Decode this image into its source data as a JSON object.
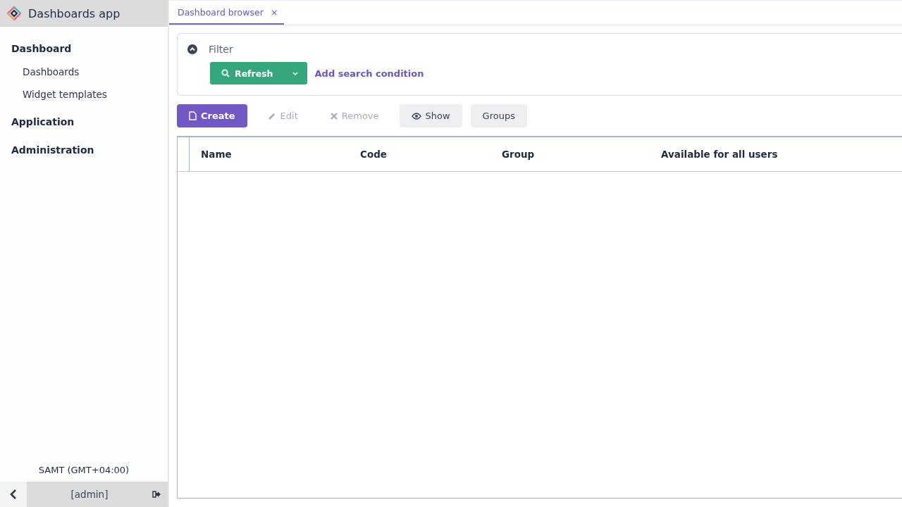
{
  "app": {
    "title": "Dashboards app"
  },
  "sidebar": {
    "sections": [
      {
        "label": "Dashboard",
        "children": [
          {
            "label": "Dashboards"
          },
          {
            "label": "Widget templates"
          }
        ]
      },
      {
        "label": "Application"
      },
      {
        "label": "Administration"
      }
    ],
    "timezone": "SAMT (GMT+04:00)",
    "user": "[admin]"
  },
  "tabs": [
    {
      "label": "Dashboard browser",
      "selected": true,
      "close": "×"
    }
  ],
  "filter": {
    "label": "Filter",
    "expanded": true,
    "refresh": "Refresh",
    "add_condition": "Add search condition"
  },
  "toolbar": [
    {
      "label": "Create",
      "kind": "primary",
      "disabled": false
    },
    {
      "label": "Edit",
      "kind": "plain",
      "disabled": true
    },
    {
      "label": "Remove",
      "kind": "plain",
      "disabled": true
    },
    {
      "label": "Show",
      "kind": "secondary",
      "disabled": false
    },
    {
      "label": "Groups",
      "kind": "secondary",
      "disabled": false
    }
  ],
  "table": {
    "columns": [
      "Name",
      "Code",
      "Group",
      "Available for all users"
    ]
  }
}
